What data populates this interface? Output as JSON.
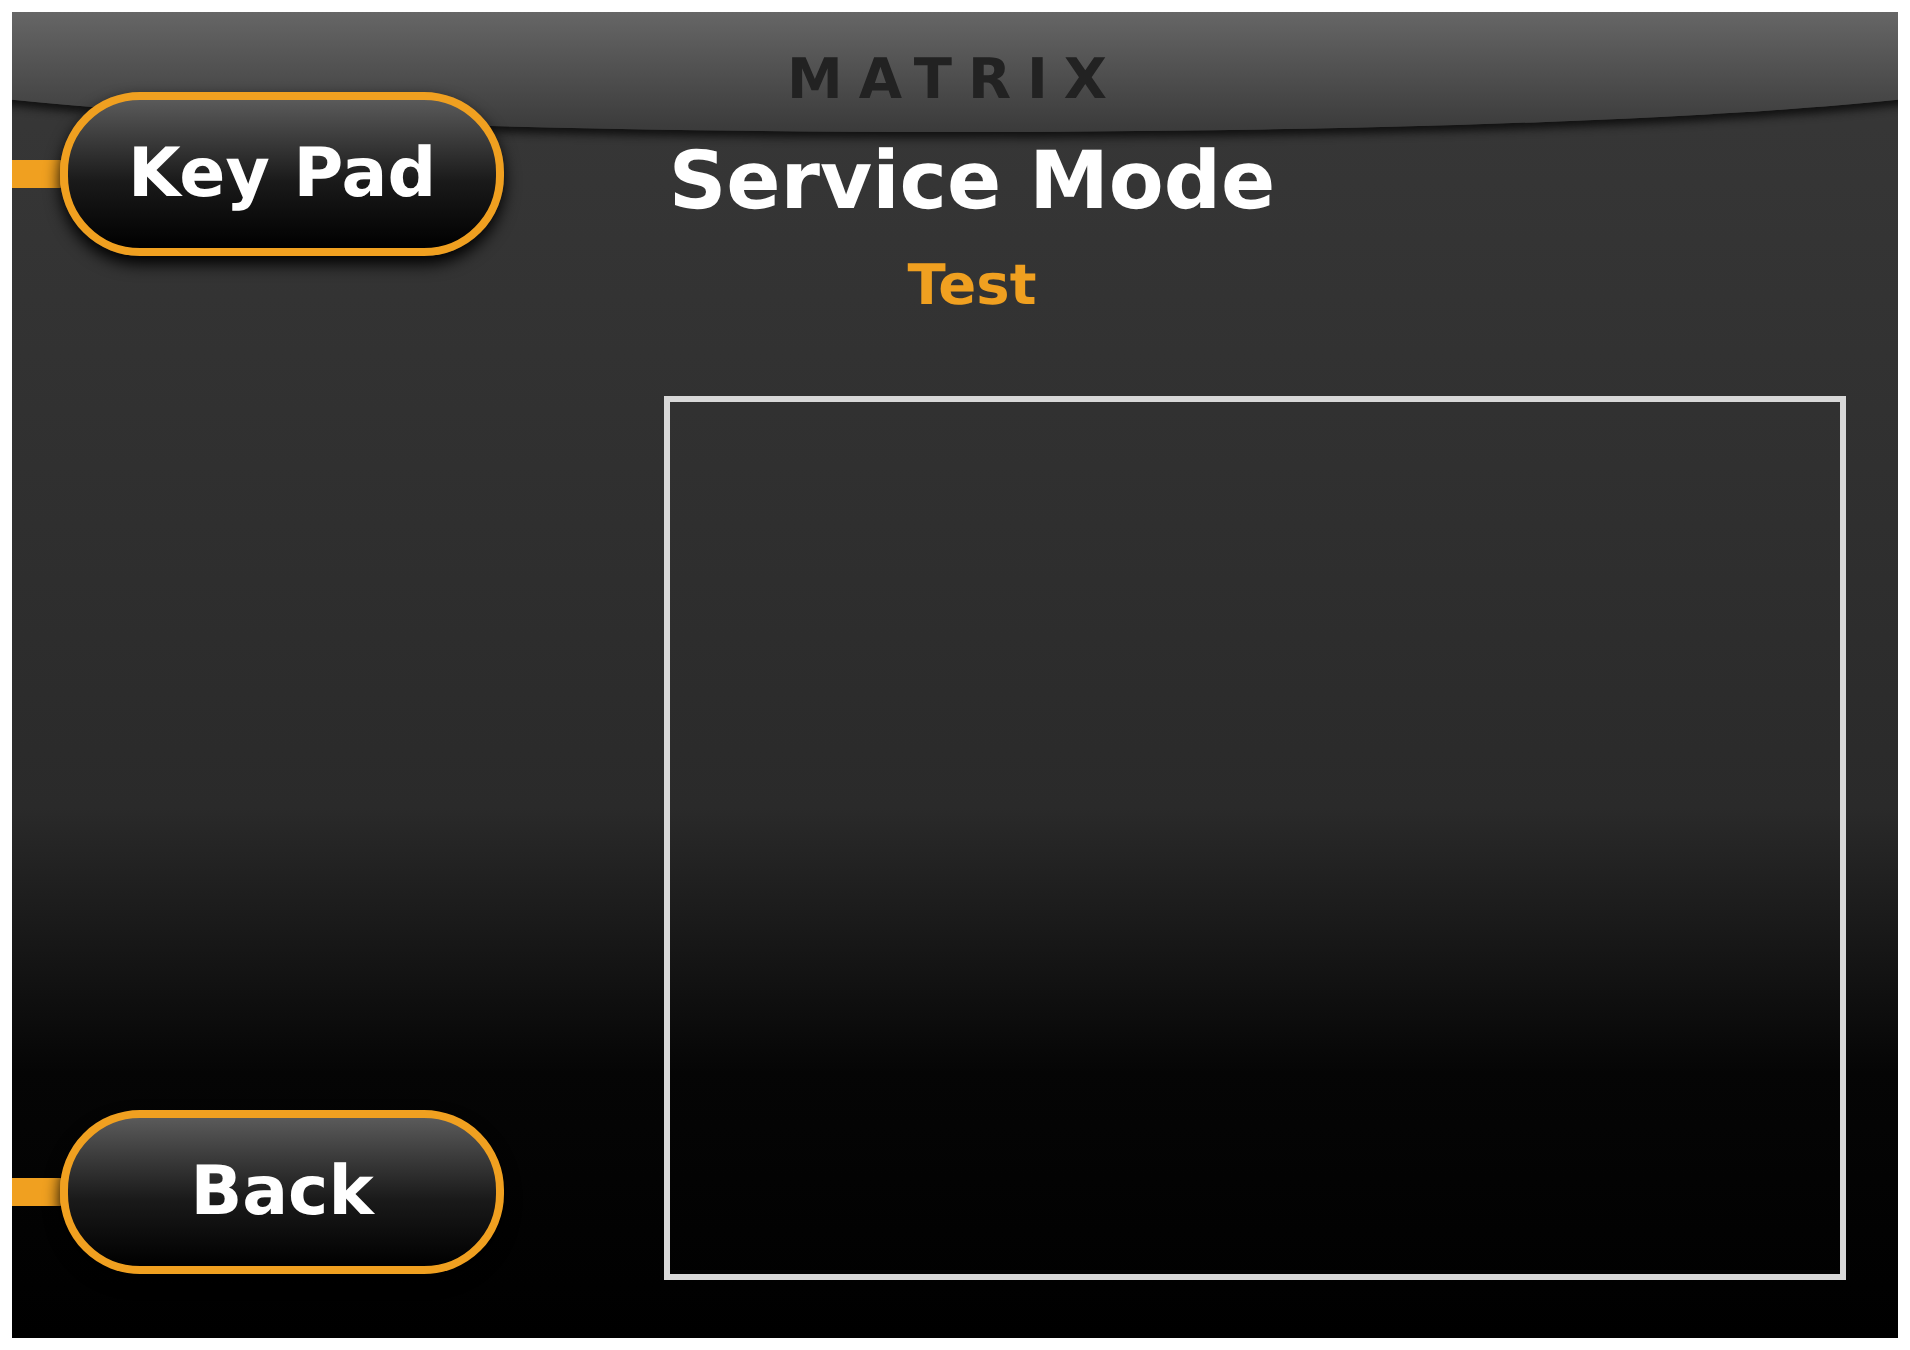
{
  "logo": "MATRIX",
  "title": "Service Mode",
  "subtitle": "Test",
  "buttons": [
    {
      "label": "Key Pad",
      "kind": "top"
    },
    {
      "label": "Back",
      "kind": "bottom"
    }
  ]
}
